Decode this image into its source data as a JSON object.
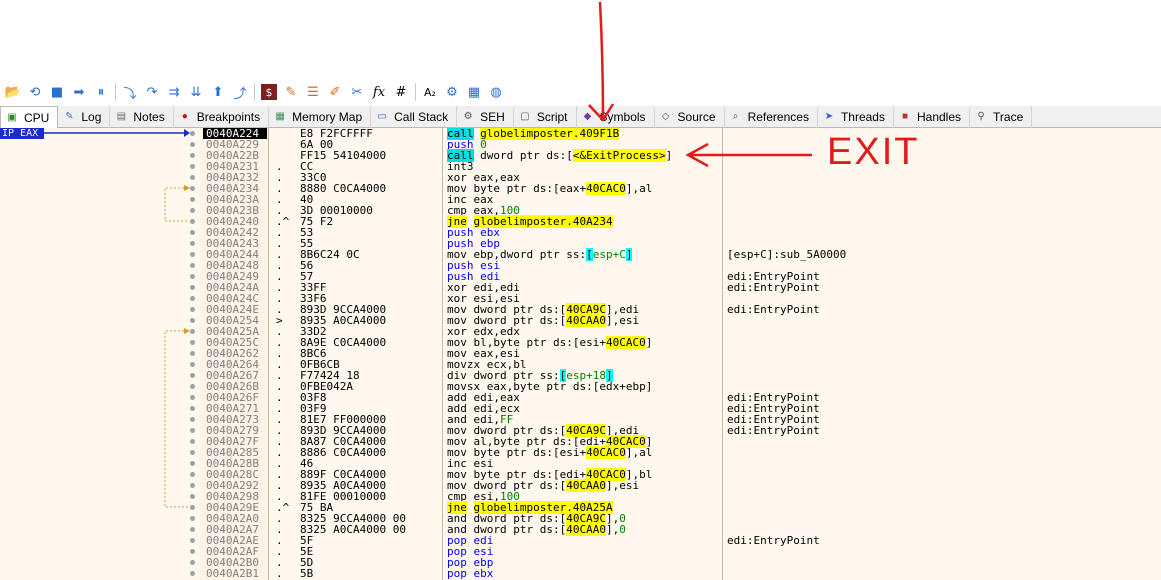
{
  "toolbar": {
    "icons": [
      "open-icon",
      "restart-icon",
      "stop-icon",
      "run-icon",
      "pause-icon",
      "step-into-icon",
      "step-over-icon",
      "trace-into-icon",
      "trace-over-icon",
      "execute-till-return-icon",
      "run-to-user-code-icon",
      "script-icon",
      "patch-icon",
      "comment-icon",
      "label-icon",
      "bookmark-icon",
      "function-icon",
      "hash-icon",
      "font-icon",
      "calculator-icon",
      "options-icon",
      "help-icon"
    ],
    "glyphs": [
      "⟲",
      "■",
      "➡",
      "⏸",
      "⤵",
      "↷",
      "⇉",
      "⇊",
      "⬆",
      "⤴",
      "$",
      "✎",
      "☰",
      "✐",
      "✂",
      "fx",
      "#",
      "A₂",
      "⚙",
      "▦",
      "◍"
    ]
  },
  "tabs": [
    {
      "label": "CPU",
      "icon": "cpu-icon",
      "active": true
    },
    {
      "label": "Log",
      "icon": "log-icon"
    },
    {
      "label": "Notes",
      "icon": "notes-icon"
    },
    {
      "label": "Breakpoints",
      "icon": "breakpoint-icon"
    },
    {
      "label": "Memory Map",
      "icon": "memory-map-icon"
    },
    {
      "label": "Call Stack",
      "icon": "call-stack-icon"
    },
    {
      "label": "SEH",
      "icon": "seh-icon"
    },
    {
      "label": "Script",
      "icon": "script-tab-icon"
    },
    {
      "label": "Symbols",
      "icon": "symbols-icon"
    },
    {
      "label": "Source",
      "icon": "source-icon"
    },
    {
      "label": "References",
      "icon": "references-icon"
    },
    {
      "label": "Threads",
      "icon": "threads-icon"
    },
    {
      "label": "Handles",
      "icon": "handles-icon"
    },
    {
      "label": "Trace",
      "icon": "trace-icon"
    }
  ],
  "ip_label": "IP EAX",
  "annotation": "EXIT",
  "rows": [
    {
      "addr": "0040A224",
      "mark": "",
      "bytes": "E8 F2FCFFFF",
      "m": "call",
      "ops": [
        {
          "t": "globelimposter.409F1B",
          "c": "y"
        }
      ],
      "comment": "",
      "cur": true
    },
    {
      "addr": "0040A229",
      "mark": "",
      "bytes": "6A 00",
      "m": "push",
      "ops": [
        {
          "t": "0",
          "c": "p"
        }
      ],
      "comment": ""
    },
    {
      "addr": "0040A22B",
      "mark": "",
      "bytes": "FF15 54104000",
      "m": "call",
      "mc": "call",
      "ops": [
        {
          "t": "dword ptr ds:["
        },
        {
          "t": "<&ExitProcess>",
          "c": "y"
        },
        {
          "t": "]"
        }
      ],
      "comment": ""
    },
    {
      "addr": "0040A231",
      "mark": ".",
      "bytes": "CC",
      "m": "int3",
      "ops": [],
      "comment": ""
    },
    {
      "addr": "0040A232",
      "mark": ".",
      "bytes": "33C0",
      "m": "xor",
      "ops": [
        {
          "t": "eax,eax"
        }
      ],
      "comment": ""
    },
    {
      "addr": "0040A234",
      "mark": ".",
      "bytes": "8880 C0CA4000",
      "m": "mov",
      "ops": [
        {
          "t": "byte ptr ds:[eax+"
        },
        {
          "t": "40CAC0",
          "c": "y"
        },
        {
          "t": "],al"
        }
      ],
      "comment": ""
    },
    {
      "addr": "0040A23A",
      "mark": ".",
      "bytes": "40",
      "m": "inc",
      "ops": [
        {
          "t": "eax"
        }
      ],
      "comment": ""
    },
    {
      "addr": "0040A23B",
      "mark": ".",
      "bytes": "3D 00010000",
      "m": "cmp",
      "ops": [
        {
          "t": "eax,"
        },
        {
          "t": "100",
          "c": "n"
        }
      ],
      "comment": ""
    },
    {
      "addr": "0040A240",
      "mark": ".^",
      "bytes": "75 F2",
      "m": "jne",
      "mc": "jmp",
      "ops": [
        {
          "t": "globelimposter.40A234",
          "c": "y"
        }
      ],
      "comment": ""
    },
    {
      "addr": "0040A242",
      "mark": ".",
      "bytes": "53",
      "m": "push",
      "ops": [
        {
          "t": "ebx"
        }
      ],
      "comment": ""
    },
    {
      "addr": "0040A243",
      "mark": ".",
      "bytes": "55",
      "m": "push",
      "ops": [
        {
          "t": "ebp"
        }
      ],
      "comment": ""
    },
    {
      "addr": "0040A244",
      "mark": ".",
      "bytes": "8B6C24 0C",
      "m": "mov",
      "ops": [
        {
          "t": "ebp,dword ptr ss:"
        },
        {
          "t": "[",
          "c": "c"
        },
        {
          "t": "esp+C",
          "c": "g"
        },
        {
          "t": "]",
          "c": "c"
        }
      ],
      "comment": "[esp+C]:sub_5A0000"
    },
    {
      "addr": "0040A248",
      "mark": ".",
      "bytes": "56",
      "m": "push",
      "ops": [
        {
          "t": "esi"
        }
      ],
      "comment": ""
    },
    {
      "addr": "0040A249",
      "mark": ".",
      "bytes": "57",
      "m": "push",
      "ops": [
        {
          "t": "edi"
        }
      ],
      "comment": "edi:EntryPoint"
    },
    {
      "addr": "0040A24A",
      "mark": ".",
      "bytes": "33FF",
      "m": "xor",
      "ops": [
        {
          "t": "edi,edi"
        }
      ],
      "comment": "edi:EntryPoint"
    },
    {
      "addr": "0040A24C",
      "mark": ".",
      "bytes": "33F6",
      "m": "xor",
      "ops": [
        {
          "t": "esi,esi"
        }
      ],
      "comment": ""
    },
    {
      "addr": "0040A24E",
      "mark": ".",
      "bytes": "893D 9CCA4000",
      "m": "mov",
      "ops": [
        {
          "t": "dword ptr ds:["
        },
        {
          "t": "40CA9C",
          "c": "y"
        },
        {
          "t": "],edi"
        }
      ],
      "comment": "edi:EntryPoint"
    },
    {
      "addr": "0040A254",
      "mark": ">",
      "bytes": "8935 A0CA4000",
      "m": "mov",
      "ops": [
        {
          "t": "dword ptr ds:["
        },
        {
          "t": "40CAA0",
          "c": "y"
        },
        {
          "t": "],esi"
        }
      ],
      "comment": ""
    },
    {
      "addr": "0040A25A",
      "mark": ".",
      "bytes": "33D2",
      "m": "xor",
      "ops": [
        {
          "t": "edx,edx"
        }
      ],
      "comment": ""
    },
    {
      "addr": "0040A25C",
      "mark": ".",
      "bytes": "8A9E C0CA4000",
      "m": "mov",
      "ops": [
        {
          "t": "bl,byte ptr ds:[esi+"
        },
        {
          "t": "40CAC0",
          "c": "y"
        },
        {
          "t": "]"
        }
      ],
      "comment": ""
    },
    {
      "addr": "0040A262",
      "mark": ".",
      "bytes": "8BC6",
      "m": "mov",
      "ops": [
        {
          "t": "eax,esi"
        }
      ],
      "comment": ""
    },
    {
      "addr": "0040A264",
      "mark": ".",
      "bytes": "0FB6CB",
      "m": "movzx",
      "ops": [
        {
          "t": "ecx,bl"
        }
      ],
      "comment": ""
    },
    {
      "addr": "0040A267",
      "mark": ".",
      "bytes": "F77424 18",
      "m": "div",
      "ops": [
        {
          "t": "dword ptr ss:"
        },
        {
          "t": "[",
          "c": "c"
        },
        {
          "t": "esp+18",
          "c": "g"
        },
        {
          "t": "]",
          "c": "c"
        }
      ],
      "comment": ""
    },
    {
      "addr": "0040A26B",
      "mark": ".",
      "bytes": "0FBE042A",
      "m": "movsx",
      "ops": [
        {
          "t": "eax,byte ptr ds:[edx+ebp]"
        }
      ],
      "comment": ""
    },
    {
      "addr": "0040A26F",
      "mark": ".",
      "bytes": "03F8",
      "m": "add",
      "ops": [
        {
          "t": "edi,eax"
        }
      ],
      "comment": "edi:EntryPoint"
    },
    {
      "addr": "0040A271",
      "mark": ".",
      "bytes": "03F9",
      "m": "add",
      "ops": [
        {
          "t": "edi,ecx"
        }
      ],
      "comment": "edi:EntryPoint"
    },
    {
      "addr": "0040A273",
      "mark": ".",
      "bytes": "81E7 FF000000",
      "m": "and",
      "ops": [
        {
          "t": "edi,"
        },
        {
          "t": "FF",
          "c": "n"
        }
      ],
      "comment": "edi:EntryPoint"
    },
    {
      "addr": "0040A279",
      "mark": ".",
      "bytes": "893D 9CCA4000",
      "m": "mov",
      "ops": [
        {
          "t": "dword ptr ds:["
        },
        {
          "t": "40CA9C",
          "c": "y"
        },
        {
          "t": "],edi"
        }
      ],
      "comment": "edi:EntryPoint"
    },
    {
      "addr": "0040A27F",
      "mark": ".",
      "bytes": "8A87 C0CA4000",
      "m": "mov",
      "ops": [
        {
          "t": "al,byte ptr ds:[edi+"
        },
        {
          "t": "40CAC0",
          "c": "y"
        },
        {
          "t": "]"
        }
      ],
      "comment": ""
    },
    {
      "addr": "0040A285",
      "mark": ".",
      "bytes": "8886 C0CA4000",
      "m": "mov",
      "ops": [
        {
          "t": "byte ptr ds:[esi+"
        },
        {
          "t": "40CAC0",
          "c": "y"
        },
        {
          "t": "],al"
        }
      ],
      "comment": ""
    },
    {
      "addr": "0040A28B",
      "mark": ".",
      "bytes": "46",
      "m": "inc",
      "ops": [
        {
          "t": "esi"
        }
      ],
      "comment": ""
    },
    {
      "addr": "0040A28C",
      "mark": ".",
      "bytes": "889F C0CA4000",
      "m": "mov",
      "ops": [
        {
          "t": "byte ptr ds:[edi+"
        },
        {
          "t": "40CAC0",
          "c": "y"
        },
        {
          "t": "],bl"
        }
      ],
      "comment": ""
    },
    {
      "addr": "0040A292",
      "mark": ".",
      "bytes": "8935 A0CA4000",
      "m": "mov",
      "ops": [
        {
          "t": "dword ptr ds:["
        },
        {
          "t": "40CAA0",
          "c": "y"
        },
        {
          "t": "],esi"
        }
      ],
      "comment": ""
    },
    {
      "addr": "0040A298",
      "mark": ".",
      "bytes": "81FE 00010000",
      "m": "cmp",
      "ops": [
        {
          "t": "esi,"
        },
        {
          "t": "100",
          "c": "n"
        }
      ],
      "comment": ""
    },
    {
      "addr": "0040A29E",
      "mark": ".^",
      "bytes": "75 BA",
      "m": "jne",
      "mc": "jmp",
      "ops": [
        {
          "t": "globelimposter.40A25A",
          "c": "y"
        }
      ],
      "comment": ""
    },
    {
      "addr": "0040A2A0",
      "mark": ".",
      "bytes": "8325 9CCA4000 00",
      "m": "and",
      "ops": [
        {
          "t": "dword ptr ds:["
        },
        {
          "t": "40CA9C",
          "c": "y"
        },
        {
          "t": "],"
        },
        {
          "t": "0",
          "c": "n"
        }
      ],
      "comment": ""
    },
    {
      "addr": "0040A2A7",
      "mark": ".",
      "bytes": "8325 A0CA4000 00",
      "m": "and",
      "ops": [
        {
          "t": "dword ptr ds:["
        },
        {
          "t": "40CAA0",
          "c": "y"
        },
        {
          "t": "],"
        },
        {
          "t": "0",
          "c": "n"
        }
      ],
      "comment": ""
    },
    {
      "addr": "0040A2AE",
      "mark": ".",
      "bytes": "5F",
      "m": "pop",
      "ops": [
        {
          "t": "edi"
        }
      ],
      "comment": "edi:EntryPoint"
    },
    {
      "addr": "0040A2AF",
      "mark": ".",
      "bytes": "5E",
      "m": "pop",
      "ops": [
        {
          "t": "esi"
        }
      ],
      "comment": ""
    },
    {
      "addr": "0040A2B0",
      "mark": ".",
      "bytes": "5D",
      "m": "pop",
      "ops": [
        {
          "t": "ebp"
        }
      ],
      "comment": ""
    },
    {
      "addr": "0040A2B1",
      "mark": ".",
      "bytes": "5B",
      "m": "pop",
      "ops": [
        {
          "t": "ebx"
        }
      ],
      "comment": ""
    }
  ]
}
